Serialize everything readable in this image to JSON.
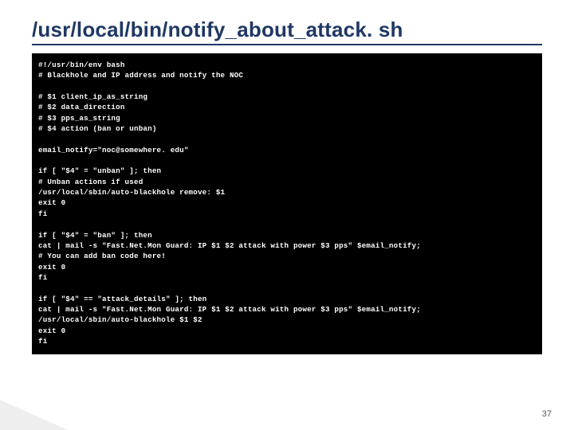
{
  "slide": {
    "title": "/usr/local/bin/notify_about_attack. sh",
    "page_number": "37"
  },
  "code": {
    "l01": "#!/usr/bin/env bash",
    "l02": "# Blackhole and IP address and notify the NOC",
    "l03": "",
    "l04": "# $1 client_ip_as_string",
    "l05": "# $2 data_direction",
    "l06": "# $3 pps_as_string",
    "l07": "# $4 action (ban or unban)",
    "l08": "",
    "l09": "email_notify=\"noc@somewhere. edu\"",
    "l10": "",
    "l11": "if [ \"$4\" = \"unban\" ]; then",
    "l12": "# Unban actions if used",
    "l13": "/usr/local/sbin/auto-blackhole remove: $1",
    "l14": "exit 0",
    "l15": "fi",
    "l16": "",
    "l17": "if [ \"$4\" = \"ban\" ]; then",
    "l18": "cat | mail -s \"Fast.Net.Mon Guard: IP $1 $2 attack with power $3 pps\" $email_notify;",
    "l19": "# You can add ban code here!",
    "l20": "exit 0",
    "l21": "fi",
    "l22": "",
    "l23": "if [ \"$4\" == \"attack_details\" ]; then",
    "l24": "cat | mail -s \"Fast.Net.Mon Guard: IP $1 $2 attack with power $3 pps\" $email_notify;",
    "l25": "/usr/local/sbin/auto-blackhole $1 $2",
    "l26": "exit 0",
    "l27": "fi"
  }
}
